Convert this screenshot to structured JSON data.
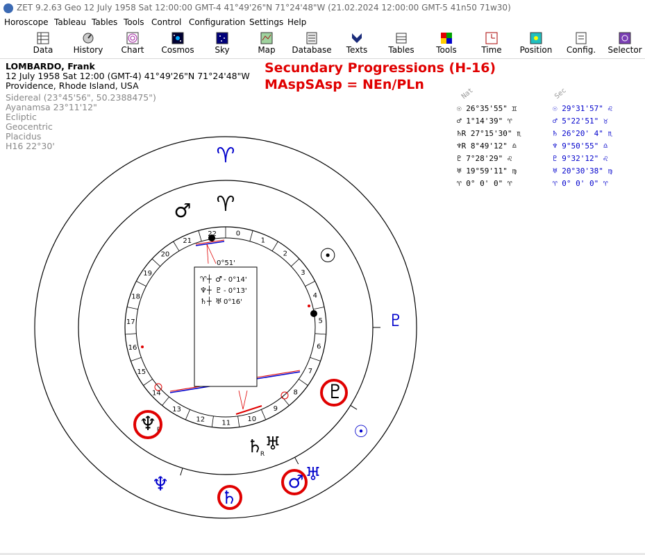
{
  "window": {
    "title": "ZET 9.2.63 Geo    12 July 1958  Sat  12:00:00 GMT-4 41°49'26\"N  71°24'48\"W  (21.02.2024  12:00:00 GMT-5 41n50 71w30)"
  },
  "menu": [
    "Horoscope",
    "Tableau",
    "Tables",
    "Tools",
    "Control",
    "Configuration",
    "Settings",
    "Help"
  ],
  "toolbar": [
    {
      "label": "Data",
      "icon": "data-icon"
    },
    {
      "label": "History",
      "icon": "history-icon"
    },
    {
      "label": "Chart",
      "icon": "chart-icon"
    },
    {
      "label": "Cosmos",
      "icon": "cosmos-icon"
    },
    {
      "label": "Sky",
      "icon": "sky-icon"
    },
    {
      "label": "Map",
      "icon": "map-icon"
    },
    {
      "label": "Database",
      "icon": "database-icon"
    },
    {
      "label": "Texts",
      "icon": "texts-icon"
    },
    {
      "label": "Tables",
      "icon": "tables-icon"
    },
    {
      "label": "Tools",
      "icon": "tools-icon"
    },
    {
      "label": "Time",
      "icon": "time-icon"
    },
    {
      "label": "Position",
      "icon": "position-icon"
    },
    {
      "label": "Config.",
      "icon": "config-icon"
    },
    {
      "label": "Selector",
      "icon": "selector-icon"
    }
  ],
  "person": {
    "name": "LOMBARDO, Frank",
    "date_line": "12 July 1958  Sat  12:00 (GMT-4) 41°49'26\"N  71°24'48\"W",
    "place": "Providence, Rhode Island, USA",
    "settings": [
      "Sidereal (23°45'56\", 50.2388475\")",
      "Ayanamsa 23°11'12\"",
      "Ecliptic",
      "Geocentric",
      "Placidus",
      "H16  22°30'"
    ]
  },
  "headline": {
    "line1": "Secundary Progressions (H-16)",
    "line2": "MAspSAsp = NEn/PLn"
  },
  "positions": {
    "header_nat": "Nat",
    "header_sec": "Sec",
    "rows": [
      {
        "nat_glyph": "☉",
        "nat": " 26°35'55\" ♊",
        "sec_glyph": "☉",
        "sec": " 29°31'57\" ♌"
      },
      {
        "nat_glyph": "♂",
        "nat": "  1°14'39\" ♈",
        "sec_glyph": "♂",
        "sec": "  5°22'51\" ♉"
      },
      {
        "nat_glyph": "♄R",
        "nat": "27°15'30\" ♏",
        "sec_glyph": "♄",
        "sec": " 26°20' 4\" ♏"
      },
      {
        "nat_glyph": "♆R",
        "nat": "  8°49'12\" ♎",
        "sec_glyph": "♆",
        "sec": "  9°50'55\" ♎"
      },
      {
        "nat_glyph": "♇",
        "nat": "  7°28'29\" ♌",
        "sec_glyph": "♇",
        "sec": "  9°32'12\" ♌"
      },
      {
        "nat_glyph": "♅",
        "nat": " 19°59'11\" ♍",
        "sec_glyph": "♅",
        "sec": " 20°30'38\" ♍"
      },
      {
        "nat_glyph": "♈",
        "nat": "  0° 0' 0\" ♈",
        "sec_glyph": "♈",
        "sec": "  0° 0' 0\" ♈"
      }
    ]
  },
  "chart": {
    "house_numbers": [
      "0",
      "1",
      "2",
      "3",
      "4",
      "5",
      "6",
      "7",
      "8",
      "9",
      "10",
      "11",
      "12",
      "13",
      "14",
      "15",
      "16",
      "17",
      "18",
      "19",
      "20",
      "21",
      "22"
    ],
    "arc_label": "0°51'",
    "legend": [
      {
        "a": "♈",
        "b": "♂",
        "orb": "- 0°14'"
      },
      {
        "a": "♆",
        "b": "♇",
        "orb": "- 0°13'"
      },
      {
        "a": "♄",
        "b": "♅",
        "orb": "0°16'"
      }
    ],
    "inner_glyphs": {
      "aries": "♈",
      "mars": "♂",
      "sun": "☉",
      "pluto": "♇",
      "neptune": "♆",
      "saturn": "♄",
      "saturn_r": "R",
      "neptune_r": "R",
      "uranus": "♅"
    },
    "outer_glyphs": {
      "aries": "♈",
      "pluto": "♇",
      "sun": "☉",
      "uranus": "♅",
      "mars": "♂",
      "saturn": "♄",
      "neptune": "♆"
    },
    "colors": {
      "natal": "#000000",
      "progressed": "#0000cc",
      "highlight": "#e00000"
    }
  }
}
